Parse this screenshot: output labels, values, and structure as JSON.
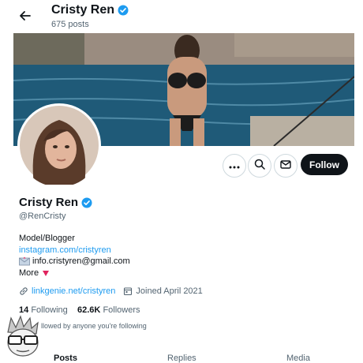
{
  "header": {
    "title": "Cristy Ren",
    "post_count": "675 posts"
  },
  "profile": {
    "name": "Cristy Ren",
    "handle": "@RenCristy",
    "bio_line": "Model/Blogger",
    "bio_link": "instagram.com/cristyren",
    "email": "info.cristyren@gmail.com",
    "more_label": "More",
    "website": "linkgenie.net/cristyren",
    "joined": "Joined April 2021"
  },
  "stats": {
    "following_count": "14",
    "following_label": "Following",
    "followers_count": "62.6K",
    "followers_label": "Followers",
    "followed_note": "llowed by anyone you're following"
  },
  "actions": {
    "follow_label": "Follow"
  },
  "tabs": [
    "Posts",
    "Replies",
    "Media"
  ],
  "colors": {
    "accent": "#1d9bf0",
    "verified": "#1d9bf0",
    "follow_bg": "#0f1419",
    "more_heart": "#e0245e"
  },
  "icons": [
    "back-arrow-icon",
    "verified-badge-icon",
    "more-icon",
    "search-icon",
    "mail-icon",
    "link-icon",
    "calendar-icon",
    "envelope-emoji-icon",
    "heart-icon"
  ]
}
